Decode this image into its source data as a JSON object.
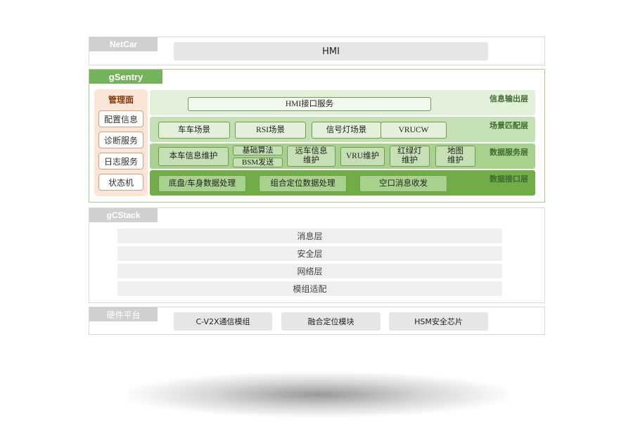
{
  "netcar": {
    "tag": "NetCar",
    "hmi": "HMI"
  },
  "gsentry": {
    "tag": "gSentry",
    "management": {
      "title": "管理面",
      "items": [
        "配置信息",
        "诊断服务",
        "日志服务",
        "状态机"
      ]
    },
    "layers": {
      "info_output": {
        "label": "信息输出层",
        "boxes": [
          "HMI接口服务"
        ]
      },
      "scene_match": {
        "label": "场景匹配层",
        "boxes": [
          "车车场景",
          "RSI场景",
          "信号灯场景",
          "VRUCW"
        ]
      },
      "data_service": {
        "label": "数据服务层",
        "boxes": [
          "本车信息维护",
          "基础算法",
          "BSM发送",
          "远车信息维护",
          "VRU维护",
          "红绿灯维护",
          "地图维护"
        ]
      },
      "data_interface": {
        "label": "数据接口层",
        "boxes": [
          "底盘/车身数据处理",
          "组合定位数据处理",
          "空口消息收发"
        ]
      }
    }
  },
  "gcstack": {
    "tag": "gCStack",
    "layers": [
      "消息层",
      "安全层",
      "网络层",
      "模组适配"
    ]
  },
  "hardware": {
    "tag": "硬件平台",
    "modules": [
      "C-V2X通信模组",
      "融合定位模块",
      "HSM安全芯片"
    ]
  },
  "colors": {
    "info_output_band": "#e3f0da",
    "scene_match_band": "#c5e0b4",
    "data_service_band": "#a9d18e",
    "data_interface_band": "#70ad47",
    "gsentry_tag": "#74b35a",
    "management_bg": "#fbe5d6"
  }
}
